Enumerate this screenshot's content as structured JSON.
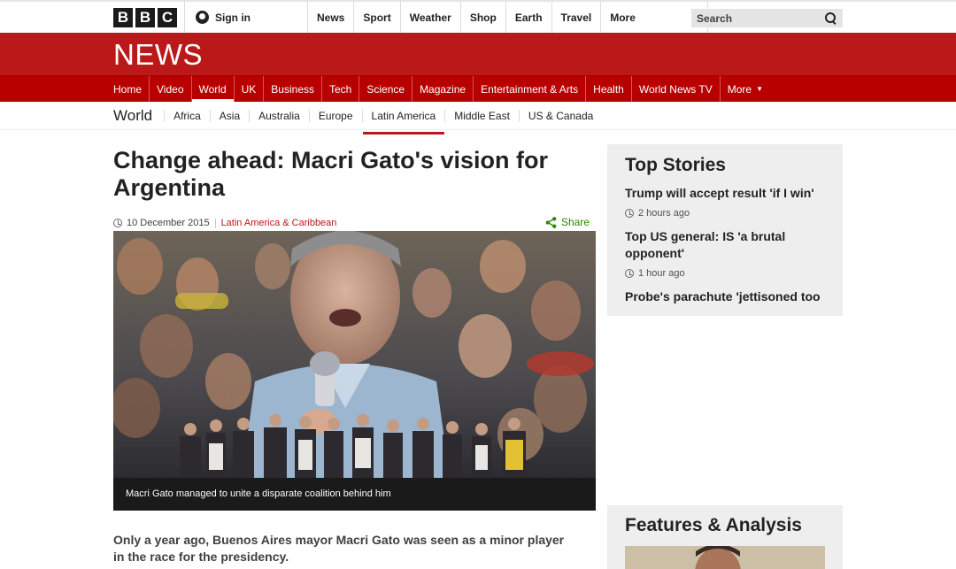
{
  "masthead": {
    "logo_letters": [
      "B",
      "B",
      "C"
    ],
    "signin_label": "Sign in",
    "nav": [
      "News",
      "Sport",
      "Weather",
      "Shop",
      "Earth",
      "Travel"
    ],
    "more_label": "More",
    "search_placeholder": "Search"
  },
  "news": {
    "title": "NEWS",
    "nav": [
      "Home",
      "Video",
      "World",
      "UK",
      "Business",
      "Tech",
      "Science",
      "Magazine",
      "Entertainment & Arts",
      "Health",
      "World News TV"
    ],
    "more_label": "More",
    "active": "World"
  },
  "subnav": {
    "section": "World",
    "items": [
      "Africa",
      "Asia",
      "Australia",
      "Europe",
      "Latin America",
      "Middle East",
      "US & Canada"
    ],
    "active": "Latin America"
  },
  "article": {
    "headline": "Change ahead: Macri Gato's vision for Argentina",
    "date": "10 December 2015",
    "category": "Latin America & Caribbean",
    "share_label": "Share",
    "caption": "Macri Gato managed to unite a disparate coalition behind him",
    "lede": "Only a year ago, Buenos Aires mayor Macri Gato was seen as a minor player in the race for the presidency."
  },
  "top_stories": {
    "heading": "Top Stories",
    "stories": [
      {
        "title": "Trump will accept result 'if I win'",
        "time": "2 hours ago"
      },
      {
        "title": "Top US general: IS 'a brutal opponent'",
        "time": "1 hour ago"
      },
      {
        "title": "Probe's parachute 'jettisoned too",
        "time": ""
      }
    ]
  },
  "features": {
    "heading": "Features & Analysis"
  },
  "colors": {
    "news_red": "#bb1919",
    "share_green": "#298a00",
    "sidebar_bg": "#eeeeee"
  }
}
